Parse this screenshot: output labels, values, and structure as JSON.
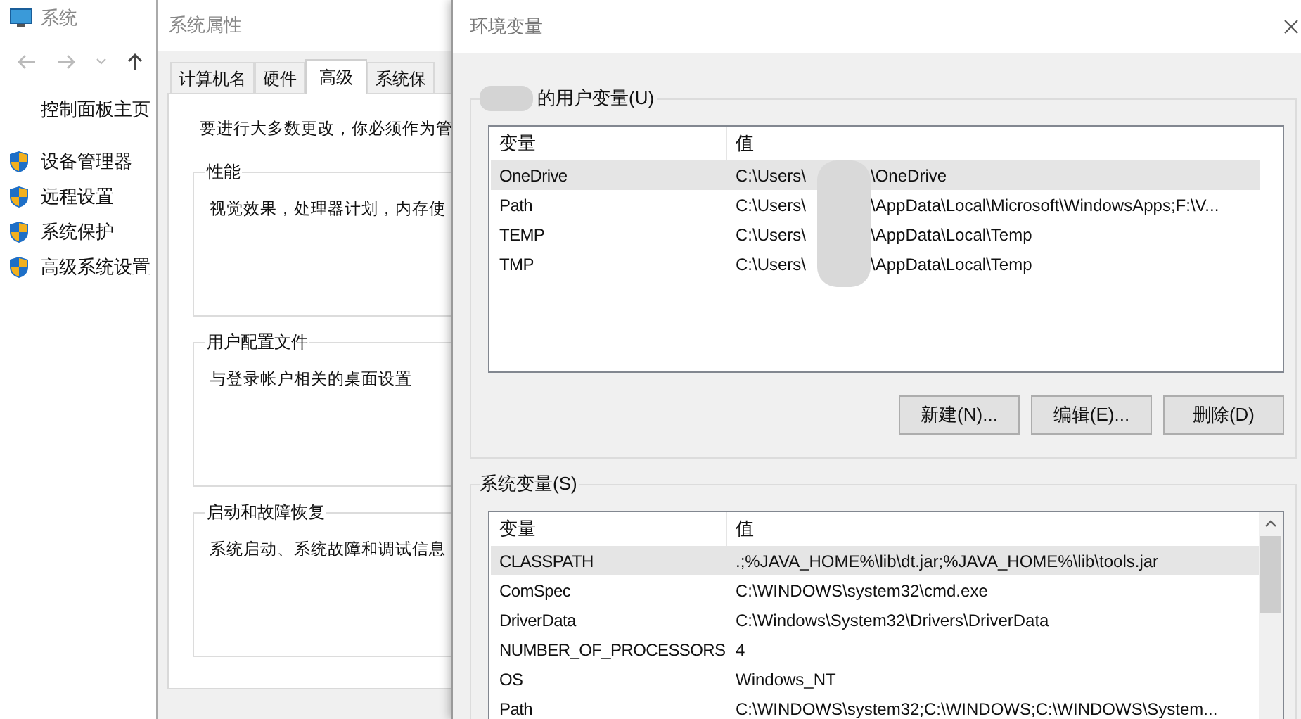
{
  "control_panel": {
    "title": "系统",
    "home_link": "控制面板主页",
    "links": [
      {
        "label": "设备管理器"
      },
      {
        "label": "远程设置"
      },
      {
        "label": "系统保护"
      },
      {
        "label": "高级系统设置"
      }
    ]
  },
  "system_properties": {
    "title": "系统属性",
    "tabs": [
      {
        "label": "计算机名",
        "selected": false
      },
      {
        "label": "硬件",
        "selected": false
      },
      {
        "label": "高级",
        "selected": true
      },
      {
        "label": "系统保",
        "selected": false
      }
    ],
    "admin_note": "要进行大多数更改，你必须作为管",
    "groups": [
      {
        "title": "性能",
        "text": "视觉效果，处理器计划，内存使"
      },
      {
        "title": "用户配置文件",
        "text": "与登录帐户相关的桌面设置"
      },
      {
        "title": "启动和故障恢复",
        "text": "系统启动、系统故障和调试信息"
      }
    ]
  },
  "environment_variables": {
    "title": "环境变量",
    "user_variables": {
      "title": "的用户变量(U)",
      "owner_redacted": true,
      "columns": [
        "变量",
        "值"
      ],
      "rows": [
        {
          "name": "OneDrive",
          "value_parts": [
            "C:\\Users\\",
            "\\OneDrive"
          ],
          "selected": true
        },
        {
          "name": "Path",
          "value_parts": [
            "C:\\Users\\",
            "\\AppData\\Local\\Microsoft\\WindowsApps;F:\\V..."
          ],
          "selected": false
        },
        {
          "name": "TEMP",
          "value_parts": [
            "C:\\Users\\",
            "\\AppData\\Local\\Temp"
          ],
          "selected": false
        },
        {
          "name": "TMP",
          "value_parts": [
            "C:\\Users\\",
            "\\AppData\\Local\\Temp"
          ],
          "selected": false
        }
      ],
      "buttons": [
        "新建(N)...",
        "编辑(E)...",
        "删除(D)"
      ]
    },
    "system_variables": {
      "title": "系统变量(S)",
      "columns": [
        "变量",
        "值"
      ],
      "rows": [
        {
          "name": "CLASSPATH",
          "value_parts": [
            ".;%JAVA_HOME%\\lib\\dt.jar;%JAVA_HOME%\\lib\\tools.jar"
          ],
          "selected": true
        },
        {
          "name": "ComSpec",
          "value_parts": [
            "C:\\WINDOWS\\system32\\cmd.exe"
          ],
          "selected": false
        },
        {
          "name": "DriverData",
          "value_parts": [
            "C:\\Windows\\System32\\Drivers\\DriverData"
          ],
          "selected": false
        },
        {
          "name": "NUMBER_OF_PROCESSORS",
          "value_parts": [
            "4"
          ],
          "selected": false
        },
        {
          "name": "OS",
          "value_parts": [
            "Windows_NT"
          ],
          "selected": false
        },
        {
          "name": "Path",
          "value_parts": [
            "C:\\WINDOWS\\system32;C:\\WINDOWS;C:\\WINDOWS\\System..."
          ],
          "selected": false
        }
      ]
    }
  }
}
